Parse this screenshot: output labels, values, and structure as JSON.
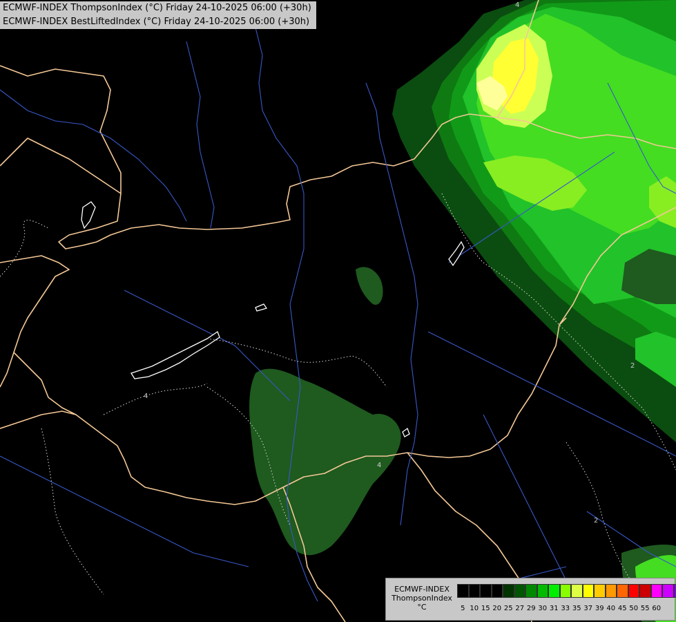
{
  "header": {
    "line1": "ECMWF-INDEX ThompsonIndex (°C) Friday 24-10-2025 06:00 (+30h)",
    "line2": "ECMWF-INDEX BestLiftedIndex (°C) Friday 24-10-2025 06:00 (+30h)"
  },
  "legend": {
    "line1": "ECMWF-INDEX",
    "line2": "ThompsonIndex",
    "line3": "°C",
    "colors": [
      "#000000",
      "#000000",
      "#000000",
      "#000000",
      "#003300",
      "#005500",
      "#008800",
      "#00bb00",
      "#00ee00",
      "#88ff00",
      "#ddff44",
      "#ffff00",
      "#ffcc00",
      "#ff9900",
      "#ff6600",
      "#ff0000",
      "#cc0000",
      "#ff00ff",
      "#cc00ff",
      "#8800ff",
      "#0000ff"
    ],
    "ticks": [
      "5",
      "10",
      "15",
      "20",
      "25",
      "27",
      "29",
      "30",
      "31",
      "33",
      "35",
      "37",
      "39",
      "40",
      "45",
      "50",
      "55",
      "60"
    ]
  },
  "map": {
    "colors": {
      "background": "#000000",
      "border": "#f4c896",
      "river": "#3858c8",
      "contour": "#ffffff",
      "dark_green": "#1f5a1f",
      "green_2": "#0f7a12",
      "green_3": "#119a18",
      "green_4": "#22c22a",
      "green_5": "#44dd22",
      "green_6": "#88ee22",
      "lime": "#ccff55",
      "yellow": "#ffff33",
      "pale_yellow": "#ffff99"
    },
    "contour_labels": [
      "4",
      "4",
      "2",
      "2",
      "4"
    ]
  }
}
